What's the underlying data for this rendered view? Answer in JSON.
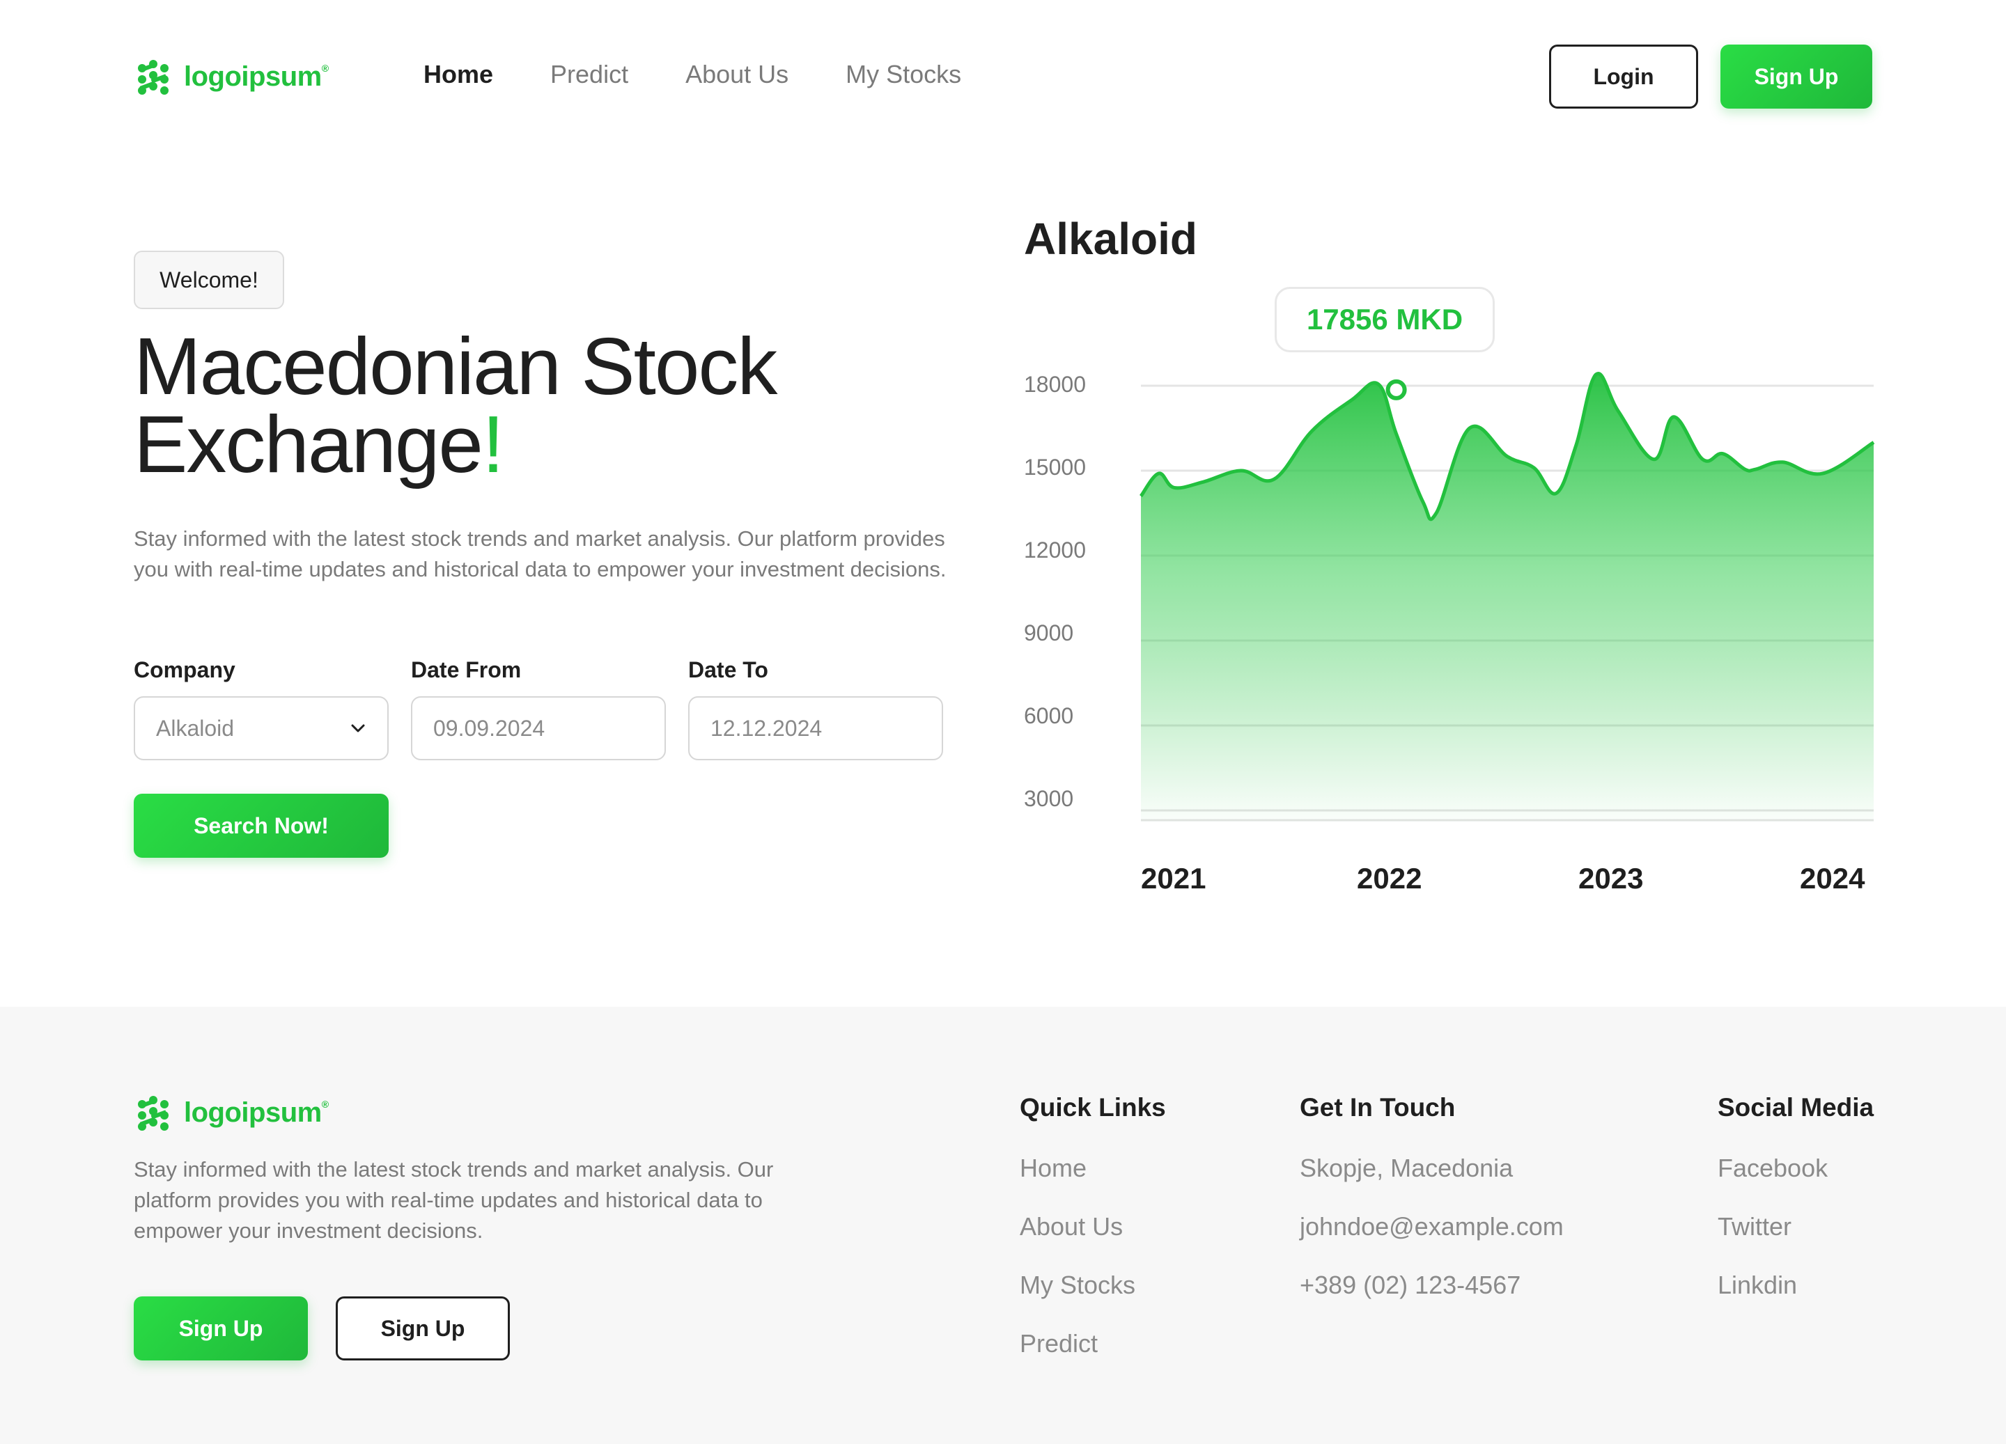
{
  "brand": {
    "name": "logoipsum",
    "mark": "®",
    "color": "#22c03e"
  },
  "nav": {
    "links": [
      "Home",
      "Predict",
      "About Us",
      "My Stocks"
    ],
    "active": "Home",
    "login_label": "Login",
    "signup_label": "Sign Up"
  },
  "hero": {
    "badge": "Welcome!",
    "title_line1": "Macedonian Stock",
    "title_line2": "Exchange",
    "title_bang": "!",
    "description": "Stay informed with the latest stock trends and market analysis. Our platform provides you with real-time updates and historical data to empower your investment decisions."
  },
  "form": {
    "company_label": "Company",
    "company_value": "Alkaloid",
    "date_from_label": "Date From",
    "date_from_value": "09.09.2024",
    "date_to_label": "Date To",
    "date_to_value": "12.12.2024",
    "search_label": "Search Now!"
  },
  "chart_data": {
    "type": "area",
    "title": "Alkaloid",
    "highlight_label": "17856 MKD",
    "highlight_x": 2022,
    "highlight_y": 17856,
    "yticks": [
      18000,
      15000,
      12000,
      9000,
      6000,
      3000
    ],
    "xticks": [
      "2021",
      "2022",
      "2023",
      "2024"
    ],
    "ylim": [
      3000,
      18000
    ],
    "xlim": [
      2020.85,
      2024.15
    ],
    "grid": true,
    "color": "#22c03e",
    "series": [
      {
        "x": [
          2020.85,
          2020.93,
          2021.0,
          2021.13,
          2021.3,
          2021.45,
          2021.62,
          2021.8,
          2021.92,
          2022.0,
          2022.12,
          2022.18,
          2022.33,
          2022.5,
          2022.62,
          2022.72,
          2022.81,
          2022.9,
          2023.0,
          2023.16,
          2023.25,
          2023.38,
          2023.47,
          2023.57,
          2023.62,
          2023.74,
          2023.92,
          2024.15
        ],
        "y": [
          14100,
          14900,
          14400,
          14600,
          15000,
          14700,
          16400,
          17500,
          18050,
          16300,
          13900,
          13500,
          16500,
          15500,
          15100,
          14200,
          15900,
          18400,
          17100,
          15400,
          16900,
          15400,
          15600,
          15050,
          15050,
          15300,
          14900,
          16000
        ]
      }
    ]
  },
  "footer": {
    "description": "Stay informed with the latest stock trends and market analysis. Our platform provides you with real-time updates and historical data to empower your investment decisions.",
    "signup_primary": "Sign Up",
    "signup_secondary": "Sign Up",
    "quick_links": {
      "title": "Quick Links",
      "items": [
        "Home",
        "About Us",
        "My Stocks",
        "Predict"
      ]
    },
    "contact": {
      "title": "Get In Touch",
      "items": [
        "Skopje, Macedonia",
        "johndoe@example.com",
        "+389 (02) 123-4567"
      ]
    },
    "social": {
      "title": "Social Media",
      "items": [
        "Facebook",
        "Twitter",
        "Linkdin"
      ]
    }
  }
}
